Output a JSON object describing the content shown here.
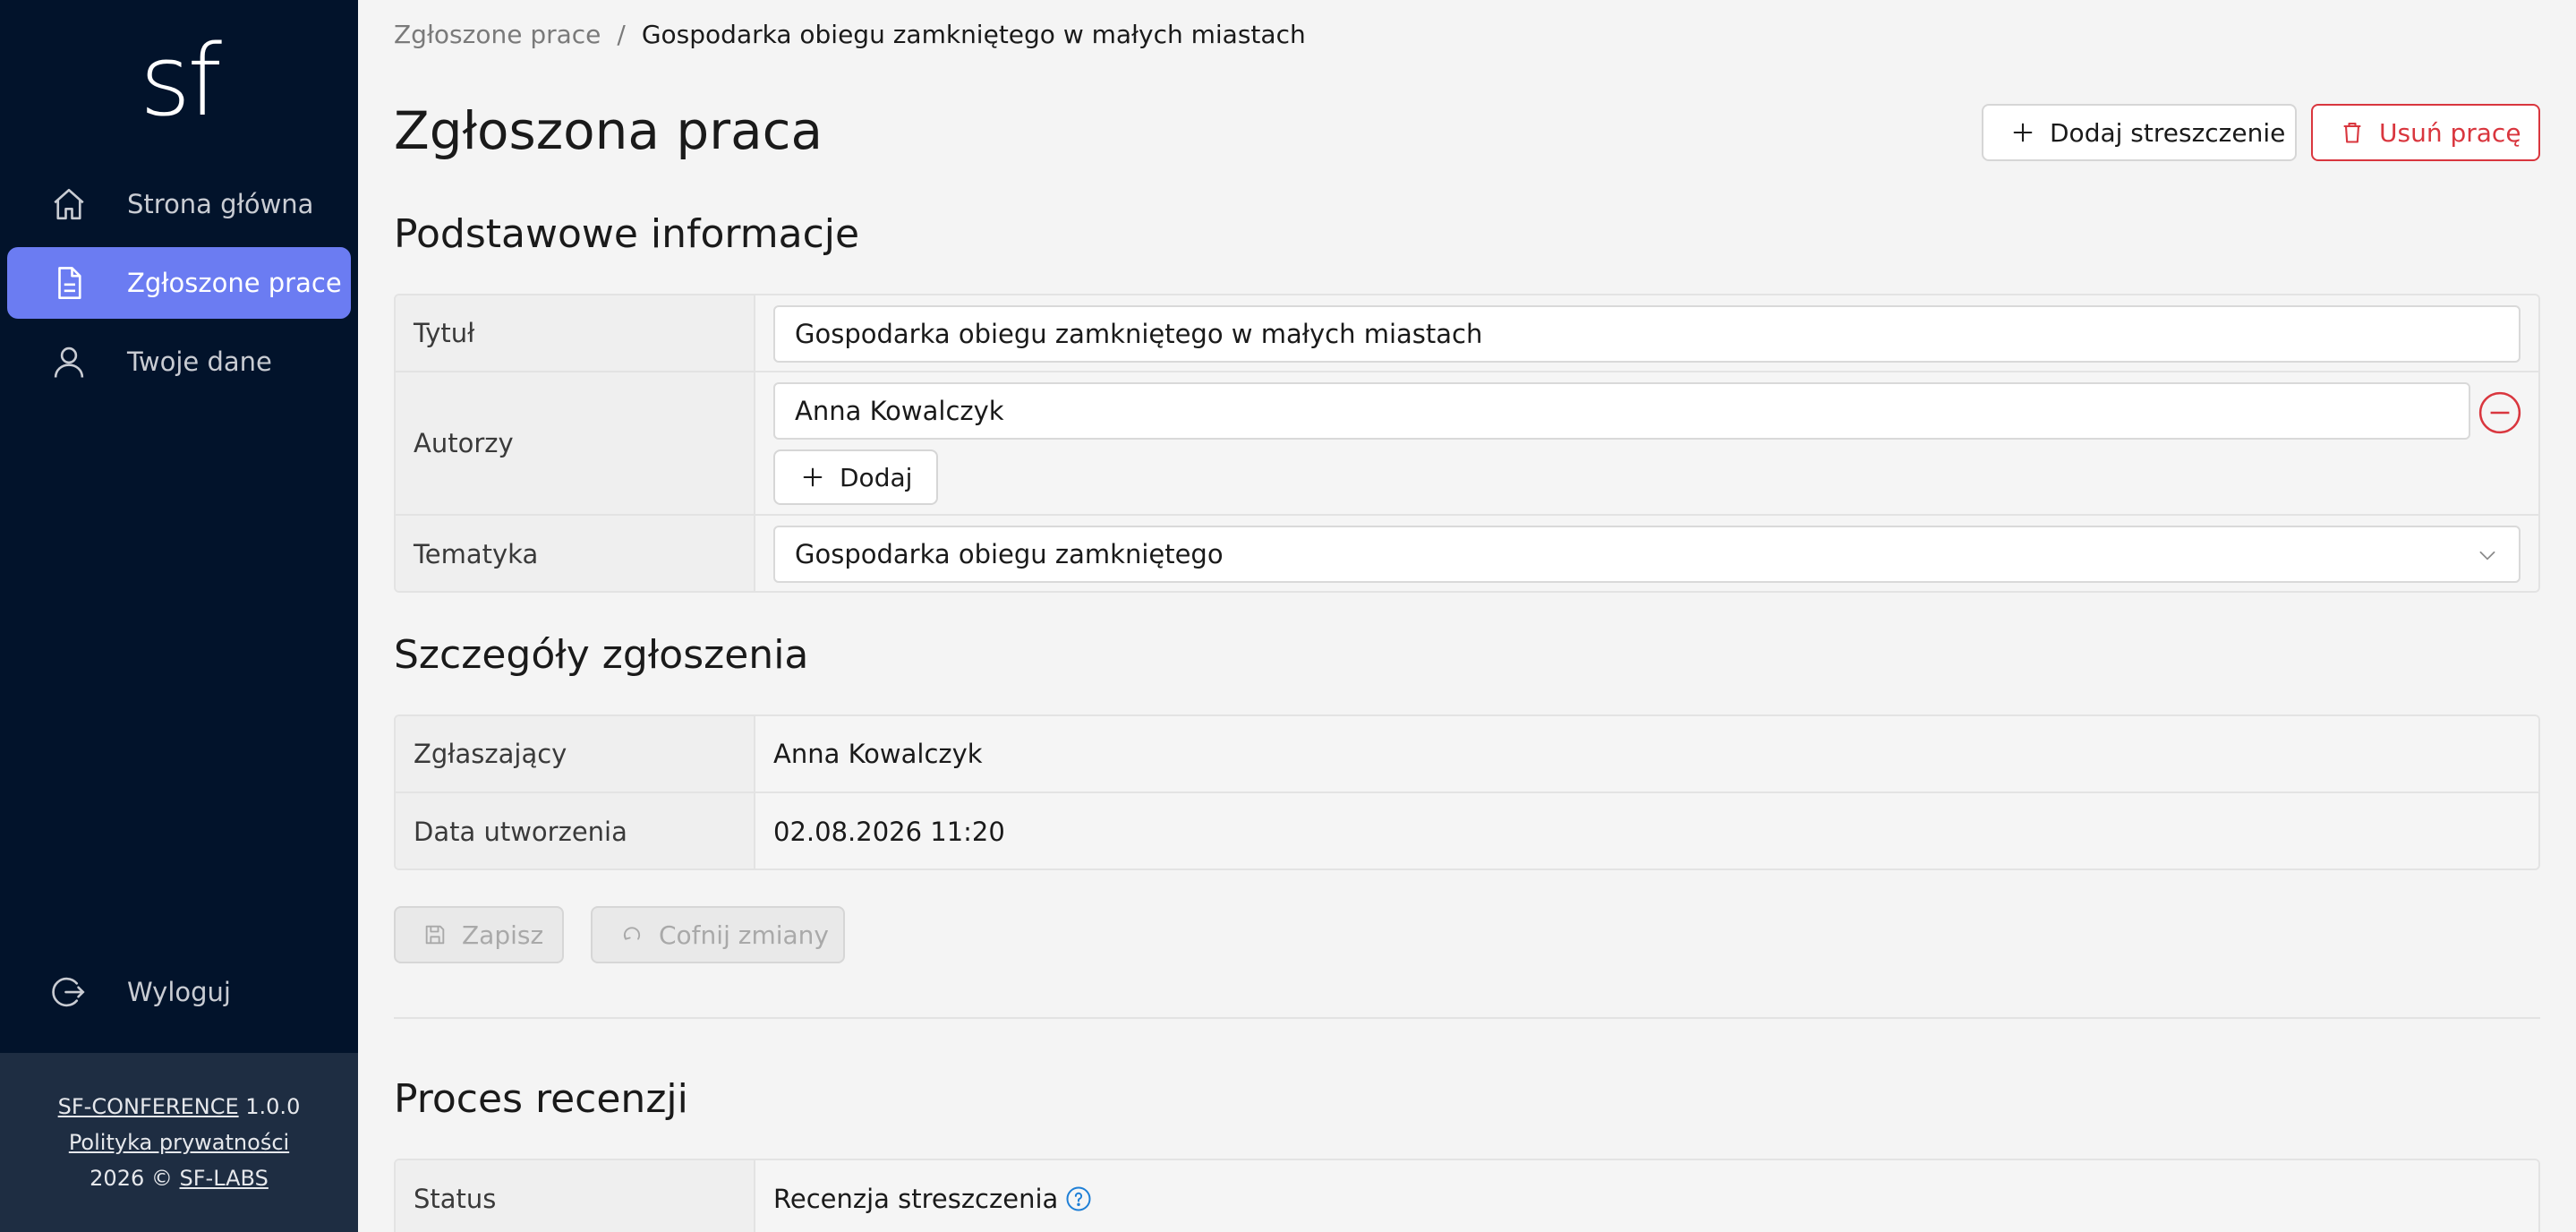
{
  "app": {
    "logo": "sf"
  },
  "sidebar": {
    "items": [
      {
        "label": "Strona główna",
        "icon": "home-icon"
      },
      {
        "label": "Zgłoszone prace",
        "icon": "document-icon",
        "active": true
      },
      {
        "label": "Twoje dane",
        "icon": "user-icon"
      }
    ],
    "logout_label": "Wyloguj",
    "footer": {
      "app_name": "SF-CONFERENCE",
      "version": "1.0.0",
      "privacy": "Polityka prywatności",
      "copyright": "2026 ©",
      "company": "SF-LABS"
    }
  },
  "breadcrumb": {
    "parent": "Zgłoszone prace",
    "separator": "/",
    "current": "Gospodarka obiegu zamkniętego w małych miastach"
  },
  "page": {
    "title": "Zgłoszona praca",
    "add_summary_label": "Dodaj streszczenie",
    "delete_label": "Usuń pracę"
  },
  "basic_info": {
    "title": "Podstawowe informacje",
    "title_label": "Tytuł",
    "title_value": "Gospodarka obiegu zamkniętego w małych miastach",
    "authors_label": "Autorzy",
    "author_1": "Anna Kowalczyk",
    "add_author_label": "Dodaj",
    "topic_label": "Tematyka",
    "topic_value": "Gospodarka obiegu zamkniętego"
  },
  "submission": {
    "title": "Szczegóły zgłoszenia",
    "submitter_label": "Zgłaszający",
    "submitter_value": "Anna Kowalczyk",
    "created_label": "Data utworzenia",
    "created_value": "02.08.2026 11:20"
  },
  "actions": {
    "save_label": "Zapisz",
    "revert_label": "Cofnij zmiany"
  },
  "review": {
    "title": "Proces recenzji",
    "status_label": "Status",
    "status_value": "Recenzja streszczenia"
  },
  "colors": {
    "sidebar_bg": "#02132b",
    "active_item": "#6b7cf2",
    "danger": "#d9363e",
    "help": "#1e7fd6"
  }
}
